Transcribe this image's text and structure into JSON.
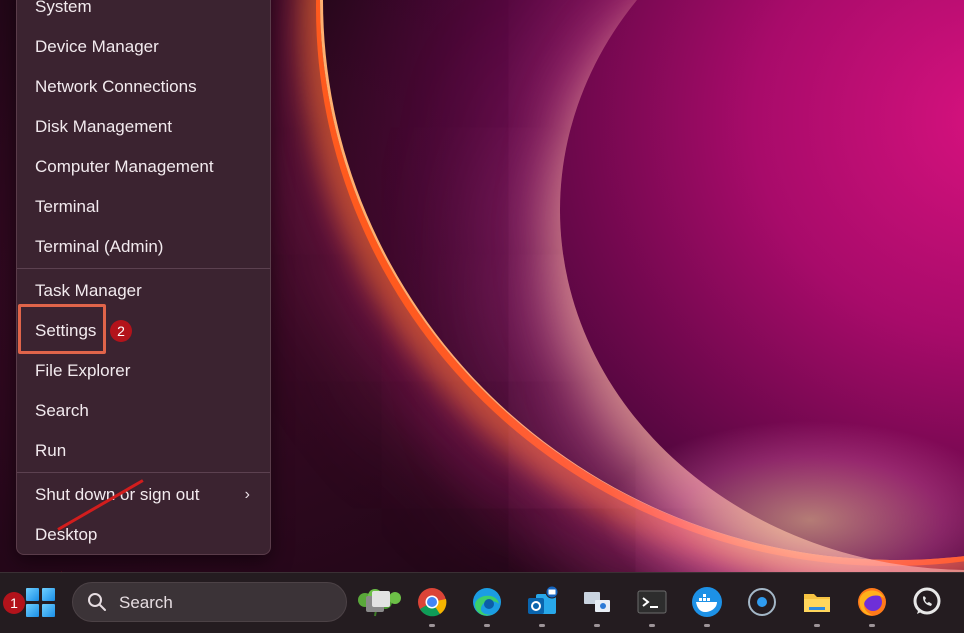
{
  "context_menu": {
    "items": [
      {
        "label": "System"
      },
      {
        "label": "Device Manager"
      },
      {
        "label": "Network Connections"
      },
      {
        "label": "Disk Management"
      },
      {
        "label": "Computer Management"
      },
      {
        "label": "Terminal"
      },
      {
        "label": "Terminal (Admin)"
      },
      {
        "label": "Task Manager"
      },
      {
        "label": "Settings"
      },
      {
        "label": "File Explorer"
      },
      {
        "label": "Search"
      },
      {
        "label": "Run"
      },
      {
        "label": "Shut down or sign out",
        "submenu_indicator": "›"
      },
      {
        "label": "Desktop"
      }
    ]
  },
  "annotations": {
    "step1": "1",
    "step2": "2",
    "highlight_color": "#e0644a",
    "badge_color": "#b3131b"
  },
  "taskbar": {
    "search_placeholder": "Search",
    "apps": [
      "start-icon",
      "task-view-icon",
      "chrome-icon",
      "edge-icon",
      "outlook-icon",
      "network-app-icon",
      "terminal-icon",
      "docker-icon",
      "cortana-icon",
      "file-explorer-icon",
      "firefox-icon",
      "whatsapp-icon"
    ]
  }
}
